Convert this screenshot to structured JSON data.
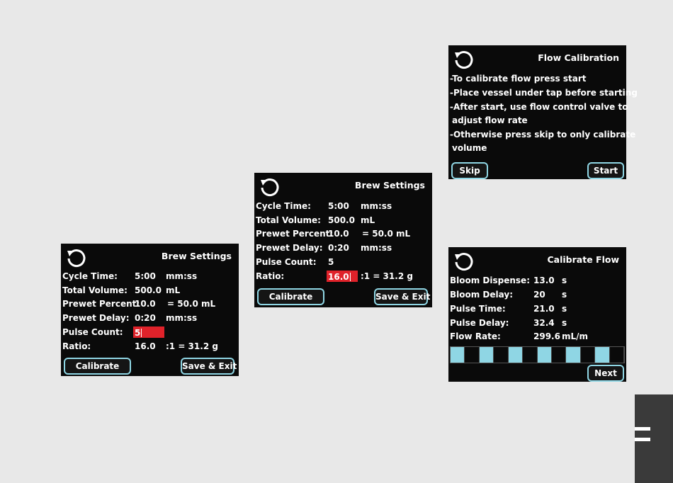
{
  "brew1": {
    "title": "Brew Settings",
    "rows": [
      {
        "label": "Cycle Time:",
        "value": "5:00",
        "unit": "mm:ss"
      },
      {
        "label": "Total Volume:",
        "value": "500.0",
        "unit": "mL"
      },
      {
        "label": "Prewet Percent:",
        "value": "10.0",
        "unit": "= 50.0 mL"
      },
      {
        "label": "Prewet Delay:",
        "value": "0:20",
        "unit": "mm:ss"
      },
      {
        "label": "Pulse Count:",
        "value": "5",
        "unit": ""
      },
      {
        "label": "Ratio:",
        "value": "16.0",
        "unit": ":1 = 31.2 g"
      }
    ],
    "calibrate_label": "Calibrate",
    "save_label": "Save & Exit"
  },
  "brew2": {
    "title": "Brew Settings",
    "rows": [
      {
        "label": "Cycle Time:",
        "value": "5:00",
        "unit": "mm:ss"
      },
      {
        "label": "Total Volume:",
        "value": "500.0",
        "unit": "mL"
      },
      {
        "label": "Prewet Percent:",
        "value": "10.0",
        "unit": "= 50.0 mL"
      },
      {
        "label": "Prewet Delay:",
        "value": "0:20",
        "unit": "mm:ss"
      },
      {
        "label": "Pulse Count:",
        "value": "5",
        "unit": ""
      },
      {
        "label": "Ratio:",
        "value": "16.0",
        "unit": ":1 = 31.2 g"
      }
    ],
    "calibrate_label": "Calibrate",
    "save_label": "Save & Exit"
  },
  "flow_cal": {
    "title": "Flow Calibration",
    "lines": [
      "-To calibrate flow press start",
      "-Place vessel under tap before starting",
      "-After start, use flow control valve to",
      " adjust flow rate",
      "-Otherwise press skip to only calibrate",
      " volume"
    ],
    "skip_label": "Skip",
    "start_label": "Start"
  },
  "cal_flow": {
    "title": "Calibrate Flow",
    "rows": [
      {
        "label": "Bloom Dispense:",
        "value": "13.0",
        "unit": "s"
      },
      {
        "label": "Bloom Delay:",
        "value": "20",
        "unit": "s"
      },
      {
        "label": "Pulse Time:",
        "value": "21.0",
        "unit": "s"
      },
      {
        "label": "Pulse Delay:",
        "value": "32.4",
        "unit": "s"
      },
      {
        "label": "Flow Rate:",
        "value": "299.6",
        "unit": "mL/m"
      }
    ],
    "progress_segments": [
      true,
      false,
      true,
      false,
      true,
      false,
      true,
      false,
      true,
      false,
      true,
      false
    ],
    "next_label": "Next"
  },
  "colors": {
    "accent": "#8fd6e4",
    "edit_highlight": "#e0222a",
    "screen_bg": "#0a0a0a",
    "page_bg": "#e8e8e8"
  },
  "icons": {
    "refresh": "refresh-icon",
    "side_tab": "menu-bars-icon"
  }
}
